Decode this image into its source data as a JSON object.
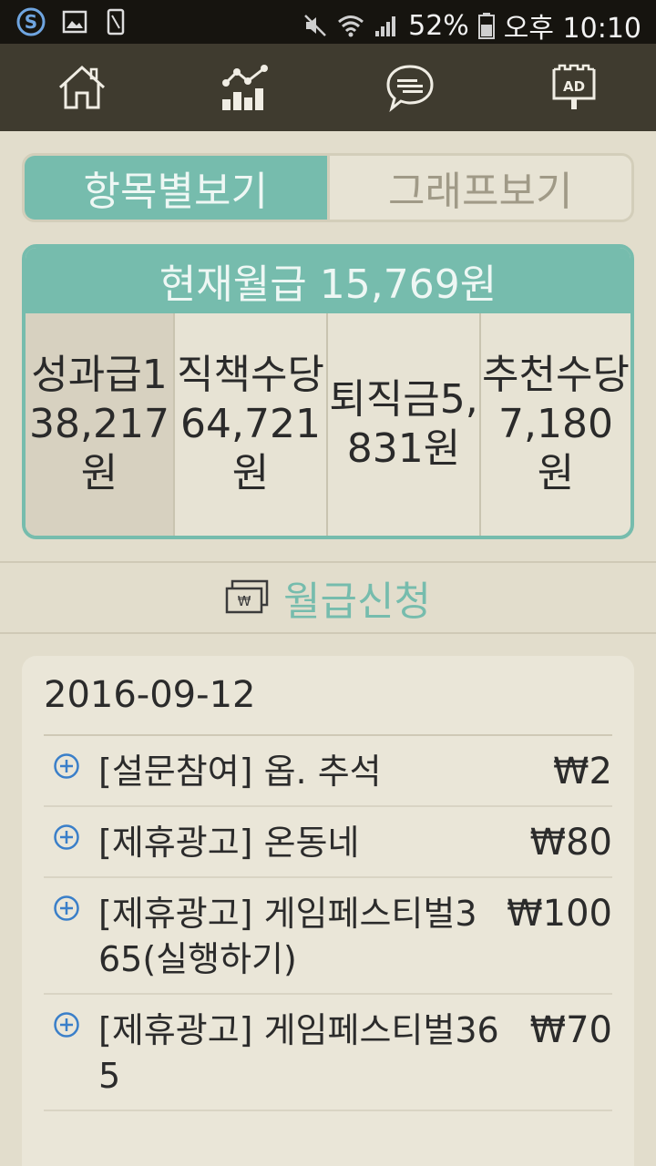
{
  "status_bar": {
    "battery_percent": "52%",
    "time": "오후 10:10",
    "icons": [
      "s-app-icon",
      "image-icon",
      "phone-icon",
      "mute-icon",
      "wifi-icon",
      "signal-icon",
      "battery-icon"
    ]
  },
  "nav": {
    "items": [
      {
        "name": "home",
        "icon": "home-icon"
      },
      {
        "name": "stats",
        "icon": "chart-icon"
      },
      {
        "name": "chat",
        "icon": "chat-icon"
      },
      {
        "name": "ad",
        "icon": "ad-icon",
        "label": "AD"
      }
    ]
  },
  "tabs": {
    "active_label": "항목별보기",
    "inactive_label": "그래프보기"
  },
  "salary": {
    "header": "현재월급 15,769원",
    "items": [
      {
        "text": "성과급138,217원"
      },
      {
        "text": "직책수당64,721원"
      },
      {
        "text": "퇴직금5,831원"
      },
      {
        "text": "추천수당7,180원"
      }
    ]
  },
  "request": {
    "label": "월급신청",
    "icon": "money-icon",
    "icon_text": "₩"
  },
  "history": {
    "date": "2016-09-12",
    "entries": [
      {
        "title": "[설문참여] 옵. 추석",
        "amount": "₩2"
      },
      {
        "title": "[제휴광고] 온동네",
        "amount": "₩80"
      },
      {
        "title": "[제휴광고] 게임페스티벌365(실행하기)",
        "amount": "₩100"
      },
      {
        "title": "[제휴광고] 게임페스티벌365",
        "amount": "₩70"
      }
    ]
  },
  "colors": {
    "accent": "#76bcad",
    "nav_bg": "#3f3b2f",
    "page_bg": "#e2ddcc",
    "plus_icon": "#3a7fc9"
  }
}
